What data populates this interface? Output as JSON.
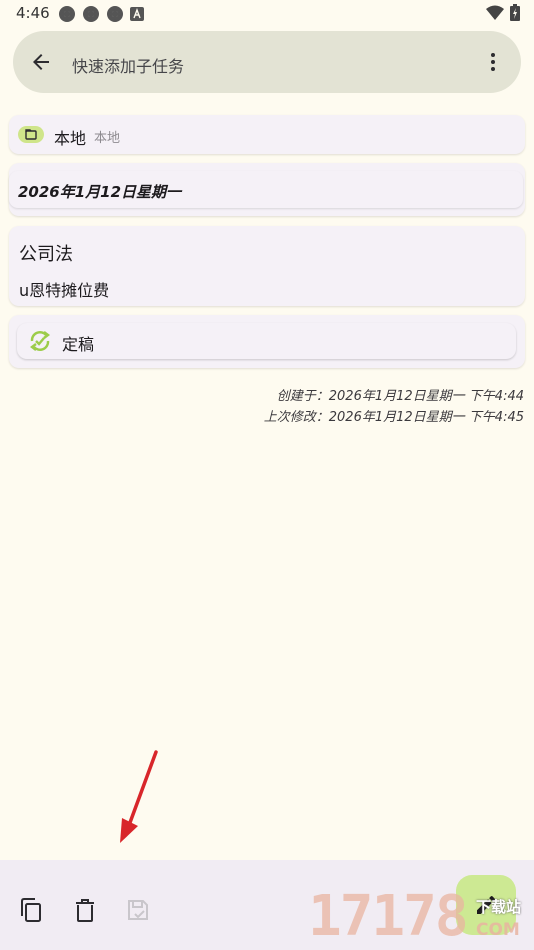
{
  "status_bar": {
    "time": "4:46"
  },
  "search": {
    "placeholder": "快速添加子任务"
  },
  "storage": {
    "name": "本地",
    "sub": "本地"
  },
  "date": {
    "text": "2026年1月12日星期一"
  },
  "task": {
    "title": "公司法",
    "description": "u恩特摊位费"
  },
  "status_chip": {
    "label": "定稿",
    "icon": "sync-check-icon"
  },
  "meta": {
    "created": "创建于：2026年1月12日星期一 下午4:44",
    "modified": "上次修改：2026年1月12日星期一 下午4:45"
  },
  "bottom_bar": {
    "icons": [
      "copy-icon",
      "delete-icon",
      "save-icon",
      "edit-icon"
    ]
  },
  "watermark": {
    "digits": "17178",
    "label": "下载站",
    "suffix": "COM"
  },
  "colors": {
    "background": "#fefbf0",
    "search_bar": "#e3e3d4",
    "card": "#f5f1f7",
    "accent_green": "#cde993",
    "chip_green": "#cfe58a",
    "annotation_red": "#d8262a"
  }
}
